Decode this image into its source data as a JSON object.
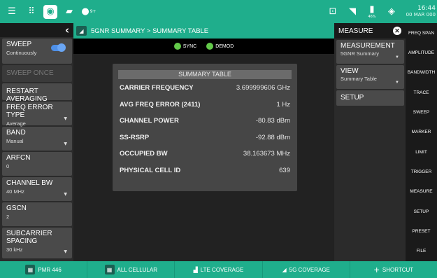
{
  "topbar": {
    "icons": [
      "menu-icon",
      "grid-icon",
      "camera-icon",
      "save-icon",
      "info-icon"
    ],
    "right_icons": [
      "export-icon",
      "wifi-icon",
      "battery-icon",
      "gps-icon"
    ],
    "info_badge": "9+",
    "battery_percent": "46%",
    "time": "16:44",
    "date": "00 MAR 000"
  },
  "header": {
    "breadcrumb": "5GNR SUMMARY  >  SUMMARY TABLE"
  },
  "status": {
    "sync_label": "SYNC",
    "demod_label": "DEMOD",
    "sync_color": "#63c94a",
    "demod_color": "#63c94a"
  },
  "left_menu": {
    "sweep": {
      "label": "SWEEP",
      "value": "Continuously"
    },
    "sweep_once": "SWEEP ONCE",
    "restart_averaging": "RESTART AVERAGING",
    "freq_error_type": {
      "label": "FREQ ERROR TYPE",
      "value": "Average"
    },
    "band": {
      "label": "BAND",
      "value": "Manual"
    },
    "arfcn": {
      "label": "ARFCN",
      "value": "0"
    },
    "channel_bw": {
      "label": "CHANNEL BW",
      "value": "40 MHz"
    },
    "gscn": {
      "label": "GSCN",
      "value": "2"
    },
    "subcarrier_spacing": {
      "label": "SUBCARRIER SPACING",
      "value": "30 kHz"
    }
  },
  "summary": {
    "title": "SUMMARY TABLE",
    "rows": [
      {
        "key": "CARRIER FREQUENCY",
        "value": "3.699999606 GHz"
      },
      {
        "key": "AVG FREQ ERROR (2411)",
        "value": "1 Hz"
      },
      {
        "key": "CHANNEL POWER",
        "value": "-80.83 dBm"
      },
      {
        "key": "SS-RSRP",
        "value": "-92.88 dBm"
      },
      {
        "key": "OCCUPIED BW",
        "value": "38.163673 MHz"
      },
      {
        "key": "PHYSICAL CELL ID",
        "value": "639"
      }
    ]
  },
  "measure_panel": {
    "title": "MEASURE",
    "measurement": {
      "label": "MEASUREMENT",
      "value": "5GNR Summary"
    },
    "view": {
      "label": "VIEW",
      "value": "Summary Table"
    },
    "setup": "SETUP"
  },
  "far_right_menu": [
    "FREQ SPAN",
    "AMPLITUDE",
    "BANDWIDTH",
    "TRACE",
    "SWEEP",
    "MARKER",
    "LIMIT",
    "TRIGGER",
    "MEASURE",
    "SETUP",
    "PRESET",
    "FILE"
  ],
  "bottom_tabs": [
    {
      "label": "PMR 446"
    },
    {
      "label": "ALL CELLULAR"
    },
    {
      "label": "LTE COVERAGE"
    },
    {
      "label": "5G COVERAGE"
    },
    {
      "label": "SHORTCUT"
    }
  ],
  "colors": {
    "accent": "#1fae8c",
    "panel": "#2b2b2b",
    "button": "#4a4a4a",
    "toggle": "#4e90e8"
  }
}
